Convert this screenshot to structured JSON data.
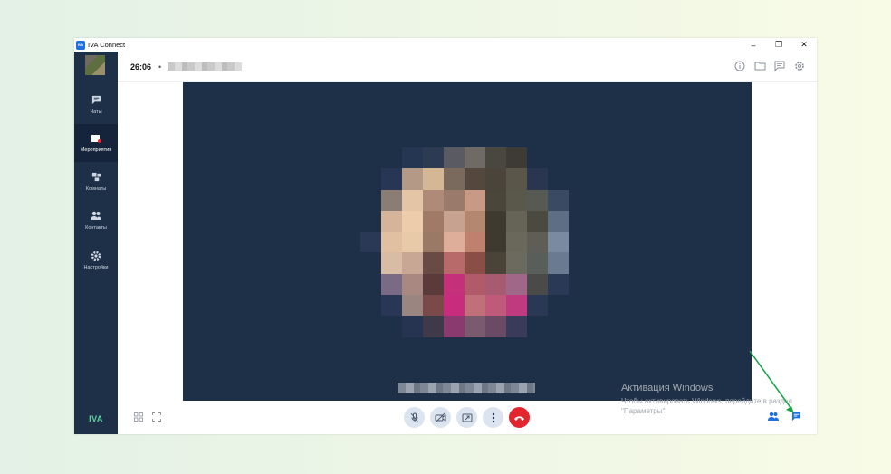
{
  "window": {
    "title": "IVA Connect",
    "logo_text": "IVA"
  },
  "window_controls": {
    "minimize": "–",
    "maximize": "❐",
    "close": "✕"
  },
  "sidebar": {
    "brand": "IVA",
    "items": [
      {
        "label": "Чаты",
        "icon": "chat-icon"
      },
      {
        "label": "Мероприятия",
        "icon": "calendar-icon",
        "active": true
      },
      {
        "label": "Комнаты",
        "icon": "rooms-icon"
      },
      {
        "label": "Контакты",
        "icon": "contacts-icon"
      },
      {
        "label": "Настройки",
        "icon": "gear-icon"
      }
    ]
  },
  "header": {
    "timer": "26:06",
    "separator": "•"
  },
  "watermark": {
    "title": "Активация Windows",
    "subtitle": "Чтобы активировать Windows, перейдите в раздел \"Параметры\"."
  },
  "colors": {
    "sidebar_bg": "#1e3048",
    "accent": "#1f6fde",
    "end_call": "#e2252f",
    "brand": "#5dd39e",
    "arrow": "#1aa34a"
  }
}
